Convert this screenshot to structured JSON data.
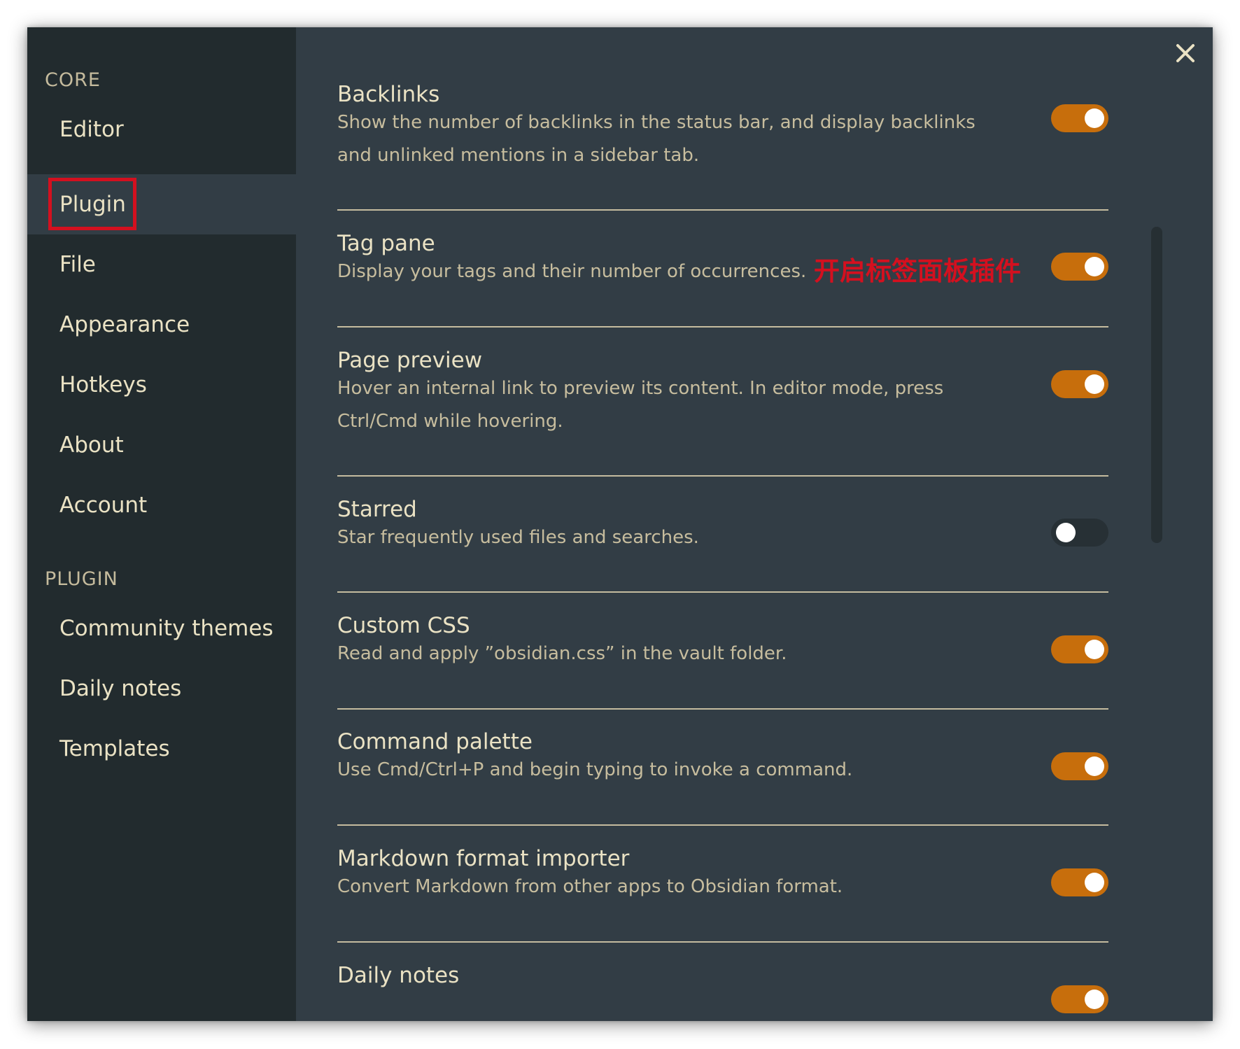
{
  "sidebar": {
    "sections": [
      {
        "header": "CORE",
        "items": [
          {
            "label": "Editor"
          },
          {
            "label": "Plugin"
          },
          {
            "label": "File"
          },
          {
            "label": "Appearance"
          },
          {
            "label": "Hotkeys"
          },
          {
            "label": "About"
          },
          {
            "label": "Account"
          }
        ]
      },
      {
        "header": "PLUGIN",
        "items": [
          {
            "label": "Community themes"
          },
          {
            "label": "Daily notes"
          },
          {
            "label": "Templates"
          }
        ]
      }
    ],
    "active_item": "Plugin"
  },
  "close_icon": "close-icon",
  "annotation": "开启标签面板插件",
  "settings": [
    {
      "title": "Backlinks",
      "desc": "Show the number of backlinks in the status bar, and display backlinks and unlinked mentions in a sidebar tab.",
      "enabled": true
    },
    {
      "title": "Tag pane",
      "desc": "Display your tags and their number of occurrences.",
      "enabled": true
    },
    {
      "title": "Page preview",
      "desc": "Hover an internal link to preview its content. In editor mode, press Ctrl/Cmd while hovering.",
      "enabled": true
    },
    {
      "title": "Starred",
      "desc": "Star frequently used files and searches.",
      "enabled": false
    },
    {
      "title": "Custom CSS",
      "desc": "Read and apply ”obsidian.css” in the vault folder.",
      "enabled": true
    },
    {
      "title": "Command palette",
      "desc": "Use Cmd/Ctrl+P and begin typing to invoke a command.",
      "enabled": true
    },
    {
      "title": "Markdown format importer",
      "desc": "Convert Markdown from other apps to Obsidian format.",
      "enabled": true
    },
    {
      "title": "Daily notes",
      "desc": "",
      "enabled": true
    }
  ],
  "colors": {
    "toggle_on": "#c76e0c",
    "toggle_off": "#273035",
    "annotation": "#d4101f",
    "sidebar_bg": "#222b2e",
    "content_bg": "#323d45"
  }
}
